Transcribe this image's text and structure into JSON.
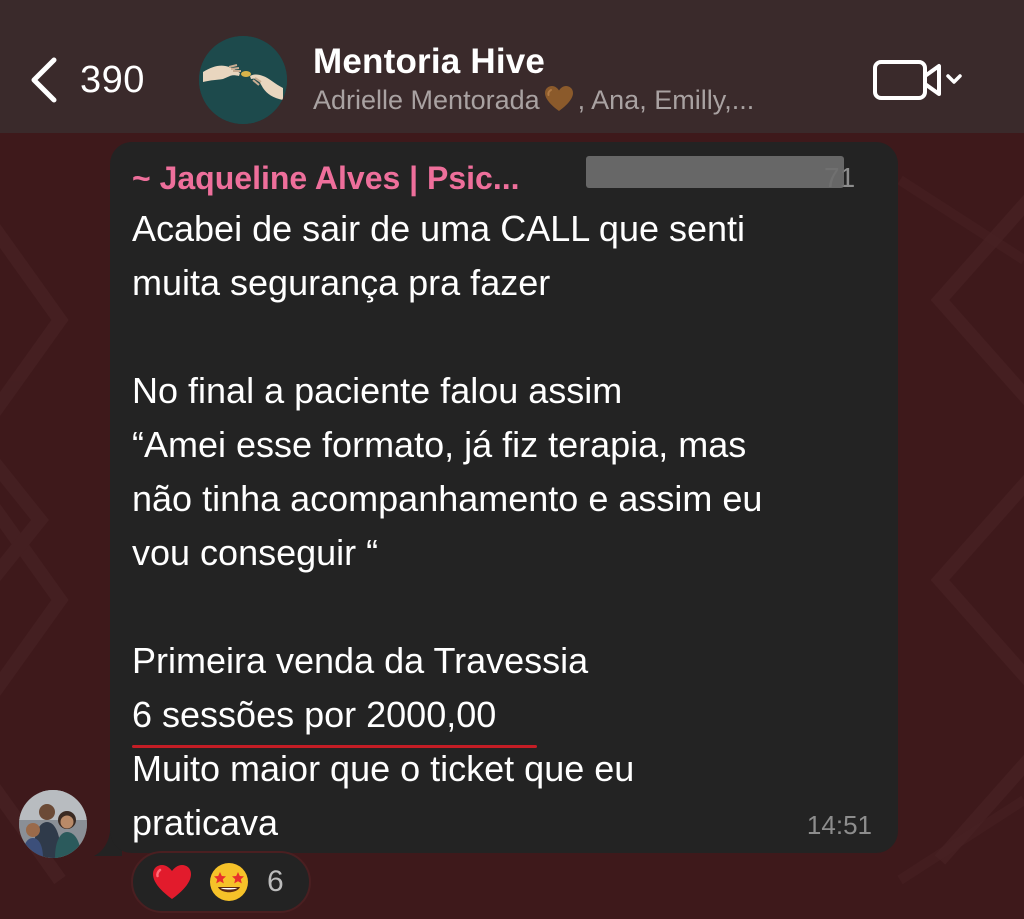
{
  "header": {
    "back_icon": "chevron-left-icon",
    "unread_count": "390",
    "group_title": "Mentoria Hive",
    "members_prefix": "Adrielle Mentorada",
    "members_suffix": ", Ana, Emilly,...",
    "video_icon": "video-camera-icon"
  },
  "message": {
    "sender_name": "~ Jaqueline Alves | Psic...",
    "sender_phone_visible": "71",
    "lines": [
      "Acabei de sair de uma CALL que senti",
      "muita segurança pra fazer",
      "",
      "No final a paciente falou assim",
      "“Amei esse formato, já fiz terapia, mas",
      "não tinha acompanhamento e assim eu",
      "vou conseguir “",
      "",
      "Primeira venda da Travessia",
      "6 sessões por 2000,00",
      "Muito maior que o ticket que eu",
      "praticava"
    ],
    "time": "14:51"
  },
  "reactions": {
    "emojis": [
      "red-heart-icon",
      "star-struck-icon"
    ],
    "count": "6"
  },
  "colors": {
    "header_bg": "#3a2a2b",
    "bubble_bg": "#232323",
    "sender_name": "#ee6f9b",
    "underline": "#c41d25",
    "wallpaper": "#3f1a1c"
  }
}
